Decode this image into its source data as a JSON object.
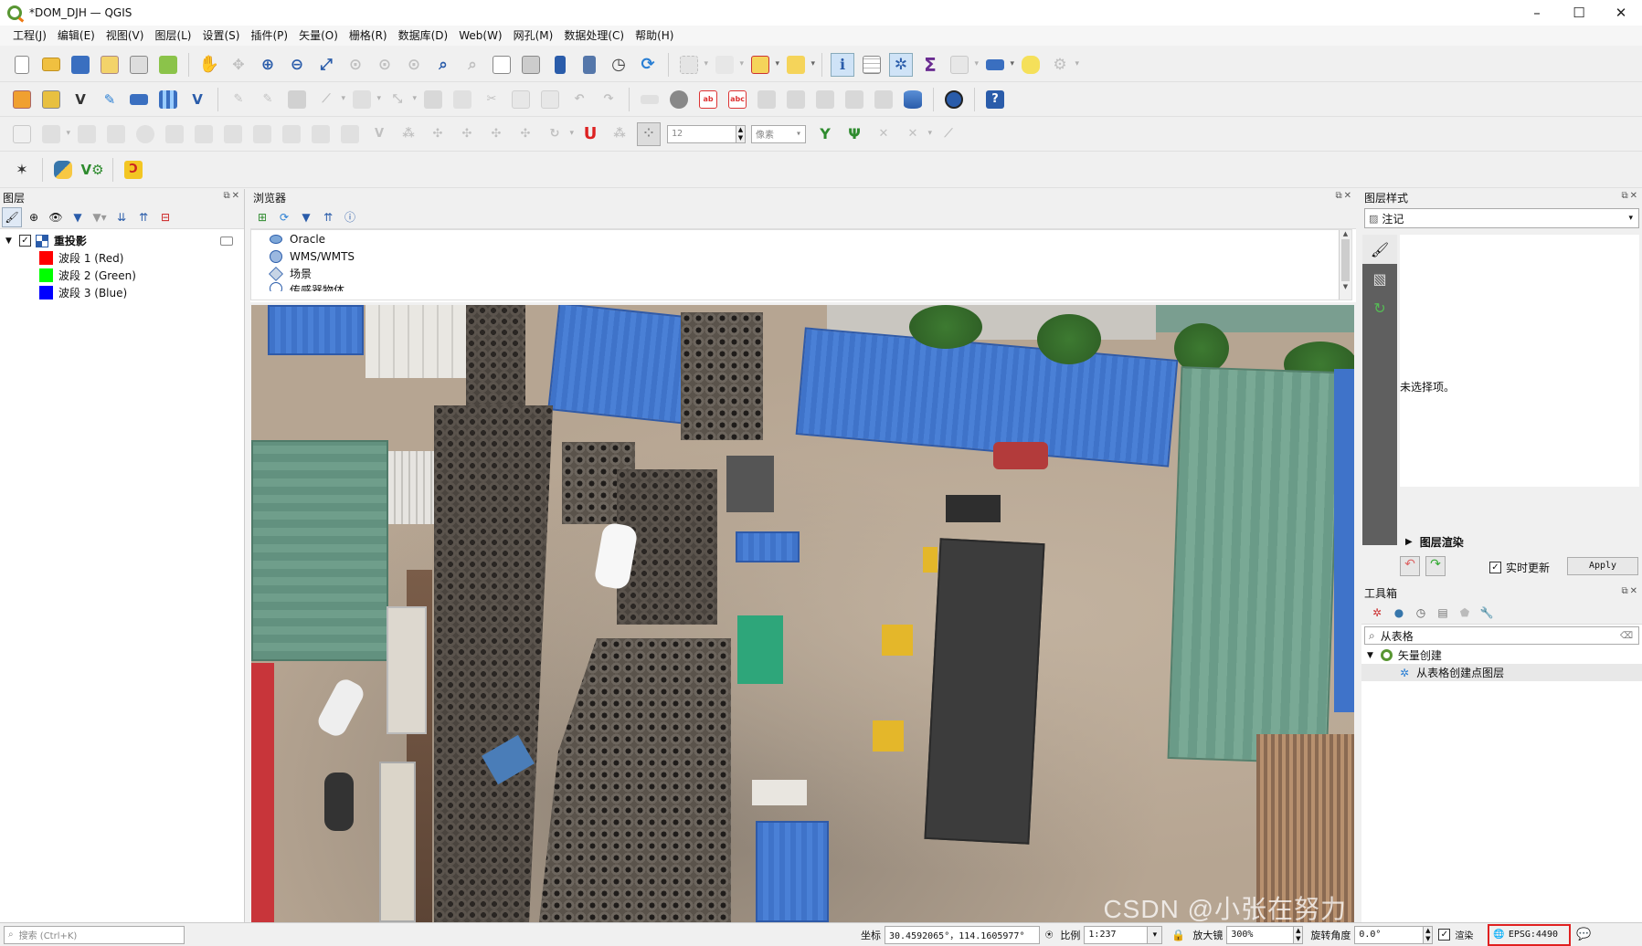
{
  "window": {
    "title": "*DOM_DJH — QGIS",
    "controls": [
      "–",
      "☐",
      "✕"
    ]
  },
  "menu": [
    "工程(J)",
    "编辑(E)",
    "视图(V)",
    "图层(L)",
    "设置(S)",
    "插件(P)",
    "矢量(O)",
    "栅格(R)",
    "数据库(D)",
    "Web(W)",
    "网孔(M)",
    "数据处理(C)",
    "帮助(H)"
  ],
  "toolbar3": {
    "snap_tolerance": "12",
    "snap_unit": "像素"
  },
  "layers_panel": {
    "title": "图层",
    "layer_name": "重投影",
    "bands": [
      {
        "label": "波段 1 (Red)",
        "color": "#ff0000"
      },
      {
        "label": "波段 2 (Green)",
        "color": "#00ff00"
      },
      {
        "label": "波段 3 (Blue)",
        "color": "#0000ff"
      }
    ]
  },
  "browser_panel": {
    "title": "浏览器",
    "items": [
      "Oracle",
      "WMS/WMTS",
      "场景",
      "传感器物体"
    ]
  },
  "style_panel": {
    "title": "图层样式",
    "renderer": "注记",
    "no_selection": "未选择项。",
    "layer_rendering": "图层渲染",
    "live_update": "实时更新",
    "apply": "Apply"
  },
  "toolbox": {
    "title": "工具箱",
    "search": "从表格",
    "group": "矢量创建",
    "algorithm": "从表格创建点图层"
  },
  "statusbar": {
    "search_placeholder": "搜索 (Ctrl+K)",
    "coord_label": "坐标",
    "coord_value": "30.4592065°，114.1605977°",
    "scale_label": "比例",
    "scale_value": "1:237",
    "magnifier_label": "放大镜",
    "magnifier_value": "300%",
    "rotation_label": "旋转角度",
    "rotation_value": "0.0°",
    "render_label": "渲染",
    "crs": "EPSG:4490"
  },
  "watermark": "CSDN @小张在努力",
  "colors": {
    "accent_green": "#589632",
    "highlight_red": "#e02020"
  }
}
